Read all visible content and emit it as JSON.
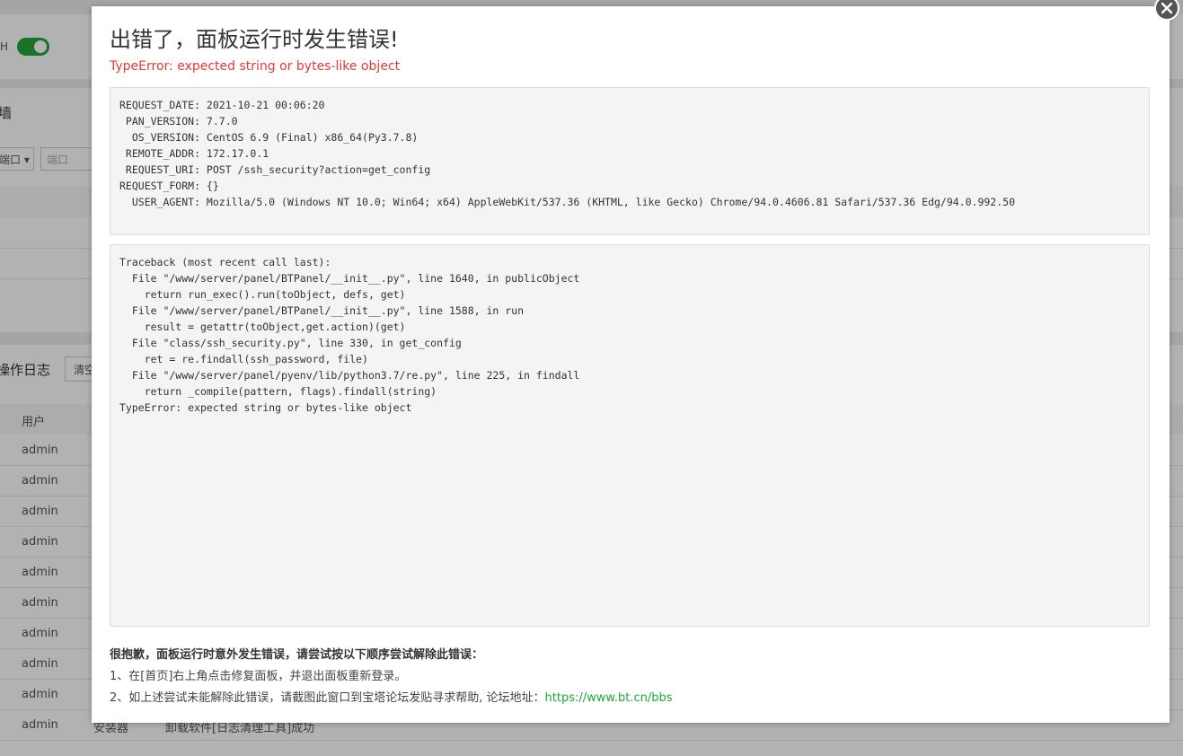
{
  "background": {
    "toggle_label": "H",
    "section_heading": "墙",
    "select_value": "端口",
    "input_placeholder": "端口",
    "log_title": "操作日志",
    "clear_button": "清空",
    "table_header_user": "用户",
    "rows": [
      "admin",
      "admin",
      "admin",
      "admin",
      "admin",
      "admin",
      "admin",
      "admin",
      "admin",
      "admin"
    ],
    "last_row_type": "安装器",
    "last_row_detail": "卸载软件[日志清理工具]成功"
  },
  "modal": {
    "title": "出错了，面板运行时发生错误!",
    "error_message": "TypeError: expected string or bytes-like object",
    "request_info": [
      "REQUEST_DATE: 2021-10-21 00:06:20",
      " PAN_VERSION: 7.7.0",
      "  OS_VERSION: CentOS 6.9 (Final) x86_64(Py3.7.8)",
      " REMOTE_ADDR: 172.17.0.1",
      " REQUEST_URI: POST /ssh_security?action=get_config",
      "REQUEST_FORM: {}",
      "  USER_AGENT: Mozilla/5.0 (Windows NT 10.0; Win64; x64) AppleWebKit/537.36 (KHTML, like Gecko) Chrome/94.0.4606.81 Safari/537.36 Edg/94.0.992.50"
    ],
    "traceback": [
      "Traceback (most recent call last):",
      "  File \"/www/server/panel/BTPanel/__init__.py\", line 1640, in publicObject",
      "    return run_exec().run(toObject, defs, get)",
      "  File \"/www/server/panel/BTPanel/__init__.py\", line 1588, in run",
      "    result = getattr(toObject,get.action)(get)",
      "  File \"class/ssh_security.py\", line 330, in get_config",
      "    ret = re.findall(ssh_password, file)",
      "  File \"/www/server/panel/pyenv/lib/python3.7/re.py\", line 225, in findall",
      "    return _compile(pattern, flags).findall(string)",
      "TypeError: expected string or bytes-like object"
    ],
    "help_title": "很抱歉，面板运行时意外发生错误，请尝试按以下顺序尝试解除此错误：",
    "help_step1": "1、在[首页]右上角点击修复面板，并退出面板重新登录。",
    "help_step2_prefix": "2、如上述尝试未能解除此错误，请截图此窗口到宝塔论坛发贴寻求帮助, 论坛地址：",
    "forum_link": "https://www.bt.cn/bbs"
  },
  "colors": {
    "error_red": "#e53935",
    "link_green": "#20a53a",
    "toggle_green": "#20a53a"
  },
  "icons": {
    "close": "close-icon"
  }
}
